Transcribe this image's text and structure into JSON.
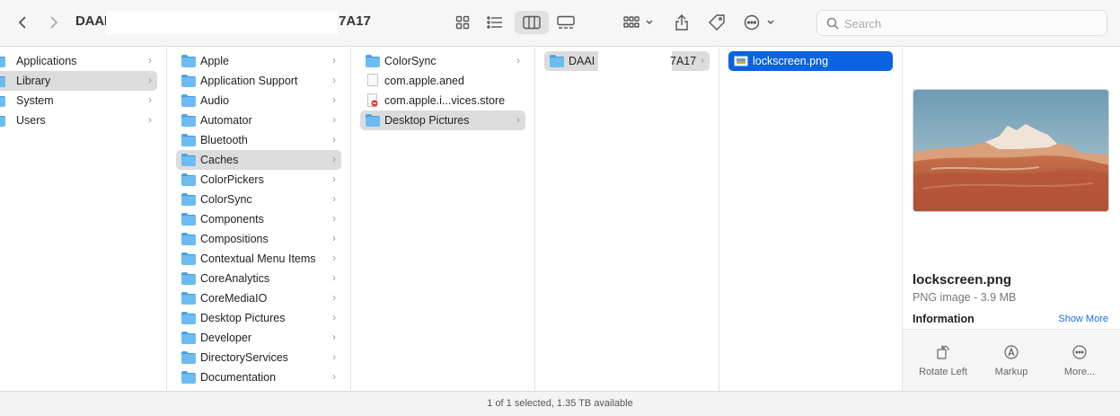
{
  "window": {
    "title_start": "DAAI",
    "title_end": "7A17"
  },
  "toolbar": {
    "back_icon": "chevron-left-icon",
    "forward_icon": "chevron-right-icon",
    "view_icons": [
      "icon-view-icon",
      "list-view-icon",
      "column-view-icon",
      "gallery-view-icon"
    ],
    "active_view": "column-view",
    "group_icon": "group-by-icon",
    "share_icon": "share-icon",
    "tag_icon": "tag-icon",
    "more_icon": "ellipsis-circle-icon"
  },
  "search": {
    "placeholder": "Search",
    "value": ""
  },
  "columns": [
    {
      "items": [
        {
          "label": "Applications",
          "type": "folder",
          "chevron": "›"
        },
        {
          "label": "Library",
          "type": "folder",
          "chevron": "›",
          "selected": true
        },
        {
          "label": "System",
          "type": "folder",
          "chevron": "›"
        },
        {
          "label": "Users",
          "type": "folder",
          "chevron": "›"
        }
      ]
    },
    {
      "items": [
        {
          "label": "Apple",
          "type": "folder",
          "chevron": "›"
        },
        {
          "label": "Application Support",
          "type": "folder",
          "chevron": "›"
        },
        {
          "label": "Audio",
          "type": "folder",
          "chevron": "›"
        },
        {
          "label": "Automator",
          "type": "folder",
          "chevron": "›"
        },
        {
          "label": "Bluetooth",
          "type": "folder",
          "chevron": "›"
        },
        {
          "label": "Caches",
          "type": "folder",
          "chevron": "›",
          "selected": true
        },
        {
          "label": "ColorPickers",
          "type": "folder",
          "chevron": "›"
        },
        {
          "label": "ColorSync",
          "type": "folder",
          "chevron": "›"
        },
        {
          "label": "Components",
          "type": "folder",
          "chevron": "›"
        },
        {
          "label": "Compositions",
          "type": "folder",
          "chevron": "›"
        },
        {
          "label": "Contextual Menu Items",
          "type": "folder",
          "chevron": "›"
        },
        {
          "label": "CoreAnalytics",
          "type": "folder",
          "chevron": "›"
        },
        {
          "label": "CoreMediaIO",
          "type": "folder",
          "chevron": "›"
        },
        {
          "label": "Desktop Pictures",
          "type": "folder",
          "chevron": "›"
        },
        {
          "label": "Developer",
          "type": "folder",
          "chevron": "›"
        },
        {
          "label": "DirectoryServices",
          "type": "folder",
          "chevron": "›"
        },
        {
          "label": "Documentation",
          "type": "folder",
          "chevron": "›"
        }
      ]
    },
    {
      "items": [
        {
          "label": "ColorSync",
          "type": "folder",
          "chevron": "›"
        },
        {
          "label": "com.apple.aned",
          "type": "file",
          "chevron": ""
        },
        {
          "label": "com.apple.i...vices.store",
          "type": "restricted-file",
          "chevron": ""
        },
        {
          "label": "Desktop Pictures",
          "type": "folder",
          "chevron": "›",
          "selected": true
        }
      ]
    },
    {
      "items": [
        {
          "label": "DAAI",
          "label_end": "7A17",
          "type": "folder",
          "chevron": "›",
          "selected": true
        }
      ]
    },
    {
      "items": [
        {
          "label": "lockscreen.png",
          "type": "image",
          "chevron": "",
          "active": true
        }
      ]
    }
  ],
  "preview": {
    "file_name": "lockscreen.png",
    "kind_size": "PNG image - 3.9 MB",
    "info_heading": "Information",
    "show_more": "Show More",
    "actions": [
      {
        "label": "Rotate Left",
        "icon": "rotate-left-icon"
      },
      {
        "label": "Markup",
        "icon": "markup-icon"
      },
      {
        "label": "More...",
        "icon": "more-icon"
      }
    ]
  },
  "status": {
    "text": "1 of 1 selected, 1.35 TB available"
  }
}
